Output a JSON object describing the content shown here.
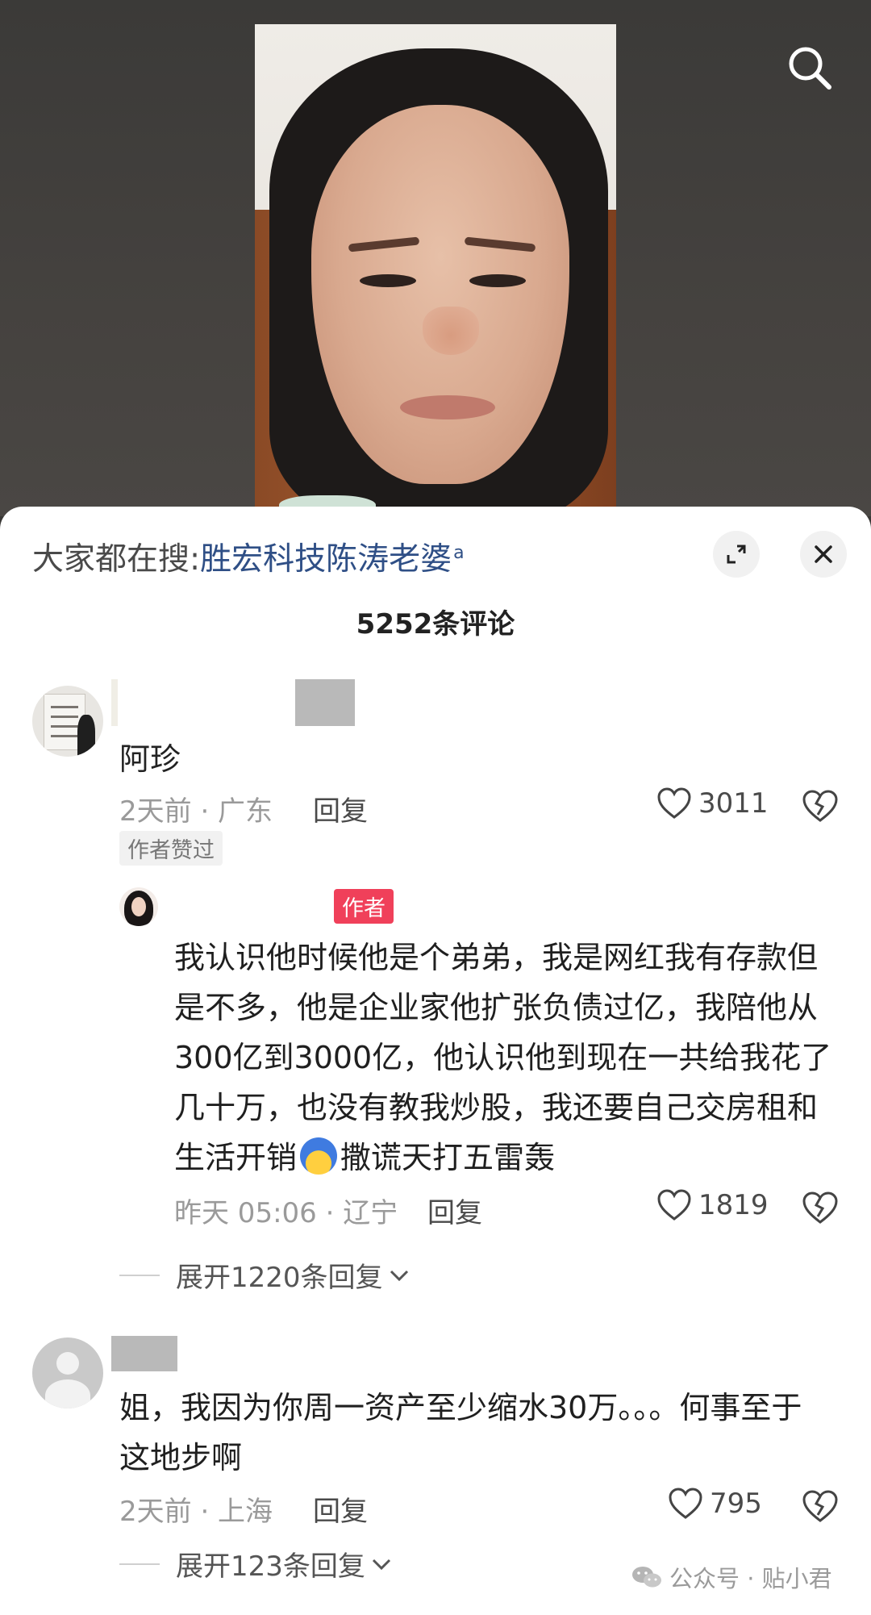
{
  "search_hint": {
    "prefix": "大家都在搜:",
    "keyword": "胜宏科技陈涛老婆",
    "suffix_icon": "search-small-icon"
  },
  "comment_count_title": "5252条评论",
  "comments": [
    {
      "username": "阿珍",
      "time_location": "2天前 · 广东",
      "reply_label": "回复",
      "likes": "3011",
      "badge": "作者赞过",
      "reply": {
        "author_badge": "作者",
        "text_part1": "我认识他时候他是个弟弟，我是网红我有存款但是不多，他是企业家他扩张负债过亿，我陪他从300亿到3000亿，他认识他到现在一共给我花了几十万，也没有教我炒股，我还要自己交房租和生活开销",
        "text_part2": "撒谎天打五雷轰",
        "time_location": "昨天 05:06 · 辽宁",
        "reply_label": "回复",
        "likes": "1819"
      },
      "expand_label": "展开1220条回复"
    },
    {
      "text": "姐，我因为你周一资产至少缩水30万。。。何事至于这地步啊",
      "time_location": "2天前 · 上海",
      "reply_label": "回复",
      "likes": "795",
      "expand_label": "展开123条回复"
    }
  ],
  "watermark": {
    "icon": "wechat-icon",
    "text": "公众号 · 贴小君"
  },
  "colors": {
    "keyword": "#2f4f86",
    "author_badge": "#f0405a",
    "meta": "#9a9a9a"
  }
}
